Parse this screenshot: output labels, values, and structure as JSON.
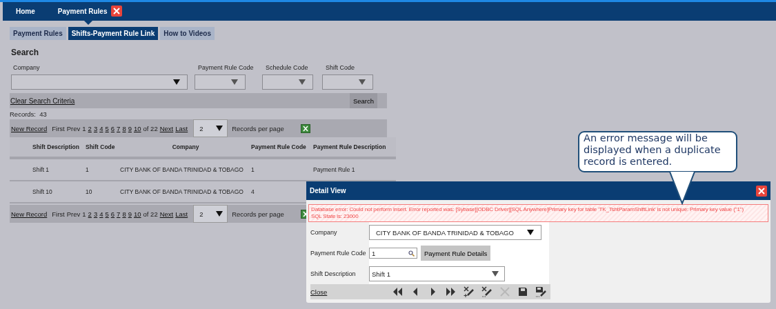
{
  "nav_tabs": [
    {
      "label": "Home",
      "selected": false,
      "closable": false
    },
    {
      "label": "Payment Rules",
      "selected": true,
      "closable": true
    }
  ],
  "sub_tabs": [
    {
      "label": "Payment Rules",
      "selected": false
    },
    {
      "label": "Shifts-Payment Rule Link",
      "selected": true
    },
    {
      "label": "How to Videos",
      "selected": false
    }
  ],
  "search": {
    "title": "Search",
    "fields": [
      {
        "label": "Company",
        "kind": "combo"
      },
      {
        "label": "Payment Rule Code",
        "kind": "dropdown"
      },
      {
        "label": "Schedule Code",
        "kind": "dropdown"
      },
      {
        "label": "Shift Code",
        "kind": "dropdown"
      }
    ],
    "clear_link": "Clear Search Criteria",
    "button": "Search"
  },
  "records": {
    "label": "Records:",
    "count": "43"
  },
  "pagers": [
    {
      "new_record": "New Record",
      "first": "First",
      "prev": "Prev",
      "pages": [
        {
          "label": "1",
          "selected": true
        },
        {
          "label": "2",
          "selected": false
        },
        {
          "label": "3",
          "selected": false
        },
        {
          "label": "4",
          "selected": false
        },
        {
          "label": "5",
          "selected": false
        },
        {
          "label": "6",
          "selected": false
        },
        {
          "label": "7",
          "selected": false
        },
        {
          "label": "8",
          "selected": false
        },
        {
          "label": "9",
          "selected": false
        },
        {
          "label": "10",
          "selected": false
        }
      ],
      "total": "of 22",
      "next": "Next",
      "last": "Last",
      "per_page": "2",
      "per_page_label": "Records per page"
    },
    {
      "new_record": "New Record",
      "first": "First",
      "prev": "Prev",
      "pages": [
        {
          "label": "1",
          "selected": true
        },
        {
          "label": "2",
          "selected": false
        },
        {
          "label": "3",
          "selected": false
        },
        {
          "label": "4",
          "selected": false
        },
        {
          "label": "5",
          "selected": false
        },
        {
          "label": "6",
          "selected": false
        },
        {
          "label": "7",
          "selected": false
        },
        {
          "label": "8",
          "selected": false
        },
        {
          "label": "9",
          "selected": false
        },
        {
          "label": "10",
          "selected": false
        }
      ],
      "total": "of 22",
      "next": "Next",
      "last": "Last",
      "per_page": "2",
      "per_page_label": "Records per page"
    }
  ],
  "table": {
    "columns": [
      "Shift Description",
      "Shift Code",
      "Company",
      "Payment Rule Code",
      "Payment Rule Description"
    ],
    "rows": [
      {
        "cells": [
          "Shift 1",
          "1",
          "CITY BANK OF BANDA TRINIDAD & TOBAGO",
          "1",
          "Payment Rule 1"
        ]
      },
      {
        "cells": [
          "Shift 10",
          "10",
          "CITY BANK OF BANDA TRINIDAD & TOBAGO",
          "4"
        ]
      }
    ]
  },
  "detail_view": {
    "title": "Detail View",
    "error_lines": [
      "Database error: Could not perform insert. Error reported was: [Sybase][ODBC Driver][SQL Anywhere]Primary key for table 'TK_TshtParamShiftLink' is not unique: Primary key value (''1'')",
      "SQL State is: 23000"
    ],
    "fields": [
      {
        "label": "Company",
        "kind": "combo",
        "value": "CITY BANK OF BANDA TRINIDAD & TOBAGO"
      },
      {
        "label": "Payment Rule Code",
        "kind": "lookup",
        "value": "1",
        "button": "Payment Rule Details"
      },
      {
        "label": "Shift Description",
        "kind": "dropdown",
        "value": "Shift 1"
      }
    ],
    "close_link": "Close",
    "toolbar": [
      {
        "kind": "first",
        "disabled": false
      },
      {
        "kind": "prev",
        "disabled": false
      },
      {
        "kind": "next",
        "disabled": false
      },
      {
        "kind": "last",
        "disabled": false
      },
      {
        "kind": "cancel-new",
        "disabled": false
      },
      {
        "kind": "cancel-edit",
        "disabled": false
      },
      {
        "kind": "delete",
        "disabled": true
      },
      {
        "kind": "save",
        "disabled": false
      },
      {
        "kind": "save-edit",
        "disabled": false
      }
    ]
  },
  "callout": {
    "text": "An error message will be displayed when a duplicate record is entered."
  }
}
